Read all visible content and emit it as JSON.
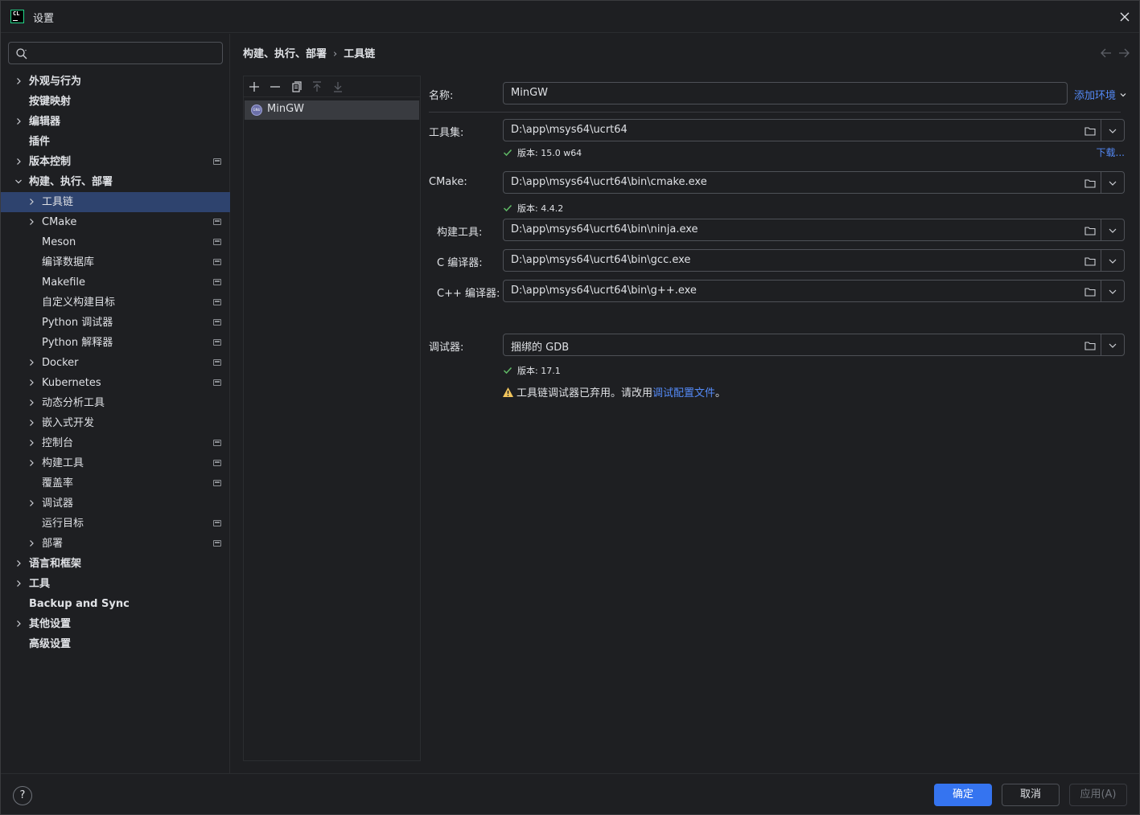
{
  "window": {
    "title": "设置",
    "app_logo_text": "CL"
  },
  "sidebar": {
    "search": {
      "value": "",
      "placeholder": ""
    },
    "tree": [
      {
        "label": "外观与行为",
        "level": 0,
        "expandable": true,
        "expanded": false,
        "project": false
      },
      {
        "label": "按键映射",
        "level": 0,
        "expandable": false,
        "project": false
      },
      {
        "label": "编辑器",
        "level": 0,
        "expandable": true,
        "expanded": false,
        "project": false
      },
      {
        "label": "插件",
        "level": 0,
        "expandable": false,
        "project": false
      },
      {
        "label": "版本控制",
        "level": 0,
        "expandable": true,
        "expanded": false,
        "project": true
      },
      {
        "label": "构建、执行、部署",
        "level": 0,
        "expandable": true,
        "expanded": true,
        "project": false
      },
      {
        "label": "工具链",
        "level": 1,
        "expandable": true,
        "expanded": false,
        "project": false,
        "selected": true
      },
      {
        "label": "CMake",
        "level": 1,
        "expandable": true,
        "expanded": false,
        "project": true
      },
      {
        "label": "Meson",
        "level": 1,
        "expandable": false,
        "project": true
      },
      {
        "label": "编译数据库",
        "level": 1,
        "expandable": false,
        "project": true
      },
      {
        "label": "Makefile",
        "level": 1,
        "expandable": false,
        "project": true
      },
      {
        "label": "自定义构建目标",
        "level": 1,
        "expandable": false,
        "project": true
      },
      {
        "label": "Python 调试器",
        "level": 1,
        "expandable": false,
        "project": true
      },
      {
        "label": "Python 解释器",
        "level": 1,
        "expandable": false,
        "project": true
      },
      {
        "label": "Docker",
        "level": 1,
        "expandable": true,
        "expanded": false,
        "project": true
      },
      {
        "label": "Kubernetes",
        "level": 1,
        "expandable": true,
        "expanded": false,
        "project": true
      },
      {
        "label": "动态分析工具",
        "level": 1,
        "expandable": true,
        "expanded": false,
        "project": false
      },
      {
        "label": "嵌入式开发",
        "level": 1,
        "expandable": true,
        "expanded": false,
        "project": false
      },
      {
        "label": "控制台",
        "level": 1,
        "expandable": true,
        "expanded": false,
        "project": true
      },
      {
        "label": "构建工具",
        "level": 1,
        "expandable": true,
        "expanded": false,
        "project": true
      },
      {
        "label": "覆盖率",
        "level": 1,
        "expandable": false,
        "project": true
      },
      {
        "label": "调试器",
        "level": 1,
        "expandable": true,
        "expanded": false,
        "project": false
      },
      {
        "label": "运行目标",
        "level": 1,
        "expandable": false,
        "project": true
      },
      {
        "label": "部署",
        "level": 1,
        "expandable": true,
        "expanded": false,
        "project": true
      },
      {
        "label": "语言和框架",
        "level": 0,
        "expandable": true,
        "expanded": false,
        "project": false
      },
      {
        "label": "工具",
        "level": 0,
        "expandable": true,
        "expanded": false,
        "project": false
      },
      {
        "label": "Backup and Sync",
        "level": 0,
        "expandable": false,
        "project": false
      },
      {
        "label": "其他设置",
        "level": 0,
        "expandable": true,
        "expanded": false,
        "project": false
      },
      {
        "label": "高级设置",
        "level": 0,
        "expandable": false,
        "project": false
      }
    ]
  },
  "breadcrumb": {
    "parent": "构建、执行、部署",
    "separator": "›",
    "current": "工具链"
  },
  "toolchains": {
    "toolbar": [
      "add-icon",
      "remove-icon",
      "copy-icon",
      "move-up-icon",
      "move-down-icon"
    ],
    "items": [
      {
        "name": "MinGW",
        "icon": "gnu-icon",
        "selected": true
      }
    ]
  },
  "form": {
    "name": {
      "label": "名称:",
      "value": "MinGW",
      "add_env": "添加环境"
    },
    "toolset": {
      "label": "工具集:",
      "value": "D:\\app\\msys64\\ucrt64",
      "version": "版本: 15.0 w64",
      "download": "下载..."
    },
    "cmake": {
      "label": "CMake:",
      "value": "D:\\app\\msys64\\ucrt64\\bin\\cmake.exe",
      "version": "版本: 4.4.2"
    },
    "build_tool": {
      "label": "构建工具:",
      "value": "D:\\app\\msys64\\ucrt64\\bin\\ninja.exe"
    },
    "c_compiler": {
      "label": "C 编译器:",
      "value": "D:\\app\\msys64\\ucrt64\\bin\\gcc.exe"
    },
    "cpp_compiler": {
      "label": "C++ 编译器:",
      "value": "D:\\app\\msys64\\ucrt64\\bin\\g++.exe"
    },
    "debugger": {
      "label": "调试器:",
      "value": "捆绑的 GDB",
      "version": "版本: 17.1"
    },
    "warning": {
      "text_before": "工具链调试器已弃用。请改用",
      "link": "调试配置文件",
      "text_after": "。"
    }
  },
  "footer": {
    "help": "?",
    "ok": "确定",
    "cancel": "取消",
    "apply": "应用(A)"
  },
  "colors": {
    "accent": "#3574f0",
    "link": "#548af7",
    "success": "#5fb865",
    "warning": "#f2c55c",
    "background": "#1e1f22",
    "selection": "#2e436e"
  }
}
